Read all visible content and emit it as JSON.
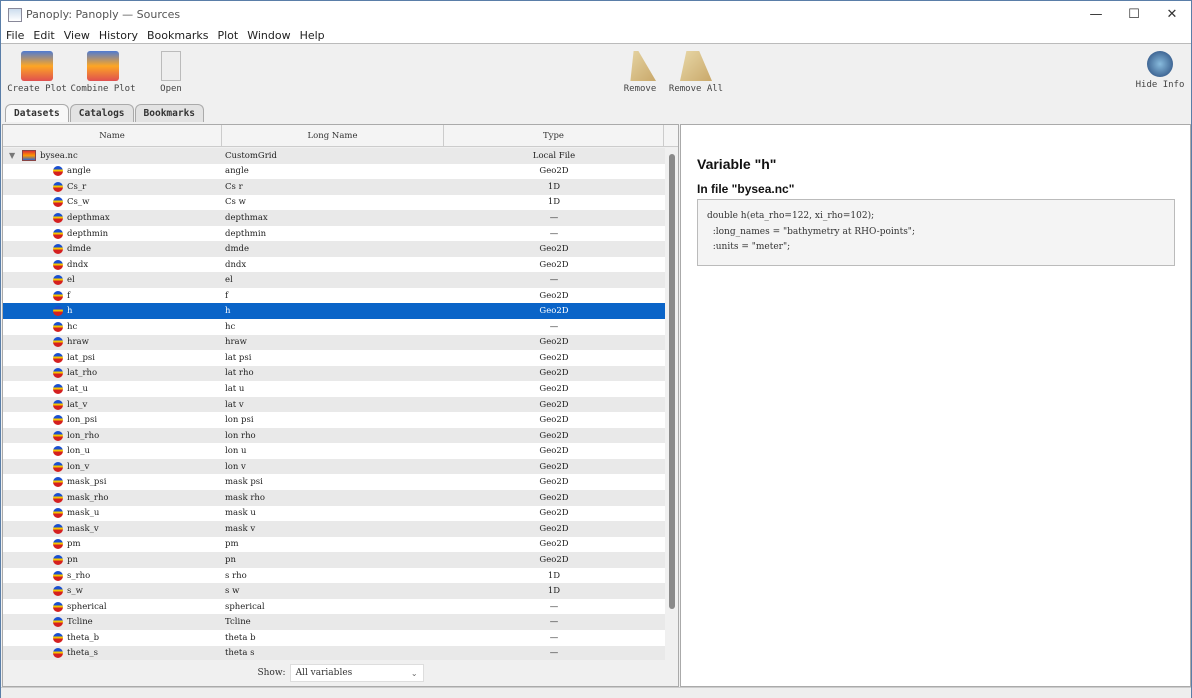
{
  "window": {
    "title": "Panoply: Panoply — Sources",
    "minimize": "—",
    "maximize": "☐",
    "close": "✕"
  },
  "menu": [
    "File",
    "Edit",
    "View",
    "History",
    "Bookmarks",
    "Plot",
    "Window",
    "Help"
  ],
  "toolbar": {
    "create_plot": "Create Plot",
    "combine_plot": "Combine Plot",
    "open": "Open",
    "remove": "Remove",
    "remove_all": "Remove All",
    "hide_info": "Hide Info"
  },
  "tabs": [
    "Datasets",
    "Catalogs",
    "Bookmarks"
  ],
  "table": {
    "headers": [
      "Name",
      "Long Name",
      "Type"
    ],
    "file": {
      "name": "bysea.nc",
      "long_name": "CustomGrid",
      "type": "Local File"
    },
    "selected": "h",
    "rows": [
      [
        "angle",
        "angle",
        "Geo2D"
      ],
      [
        "Cs_r",
        "Cs r",
        "1D"
      ],
      [
        "Cs_w",
        "Cs w",
        "1D"
      ],
      [
        "depthmax",
        "depthmax",
        "—"
      ],
      [
        "depthmin",
        "depthmin",
        "—"
      ],
      [
        "dmde",
        "dmde",
        "Geo2D"
      ],
      [
        "dndx",
        "dndx",
        "Geo2D"
      ],
      [
        "el",
        "el",
        "—"
      ],
      [
        "f",
        "f",
        "Geo2D"
      ],
      [
        "h",
        "h",
        "Geo2D"
      ],
      [
        "hc",
        "hc",
        "—"
      ],
      [
        "hraw",
        "hraw",
        "Geo2D"
      ],
      [
        "lat_psi",
        "lat psi",
        "Geo2D"
      ],
      [
        "lat_rho",
        "lat rho",
        "Geo2D"
      ],
      [
        "lat_u",
        "lat u",
        "Geo2D"
      ],
      [
        "lat_v",
        "lat v",
        "Geo2D"
      ],
      [
        "lon_psi",
        "lon psi",
        "Geo2D"
      ],
      [
        "lon_rho",
        "lon rho",
        "Geo2D"
      ],
      [
        "lon_u",
        "lon u",
        "Geo2D"
      ],
      [
        "lon_v",
        "lon v",
        "Geo2D"
      ],
      [
        "mask_psi",
        "mask psi",
        "Geo2D"
      ],
      [
        "mask_rho",
        "mask rho",
        "Geo2D"
      ],
      [
        "mask_u",
        "mask u",
        "Geo2D"
      ],
      [
        "mask_v",
        "mask v",
        "Geo2D"
      ],
      [
        "pm",
        "pm",
        "Geo2D"
      ],
      [
        "pn",
        "pn",
        "Geo2D"
      ],
      [
        "s_rho",
        "s rho",
        "1D"
      ],
      [
        "s_w",
        "s w",
        "1D"
      ],
      [
        "spherical",
        "spherical",
        "—"
      ],
      [
        "Tcline",
        "Tcline",
        "—"
      ],
      [
        "theta_b",
        "theta b",
        "—"
      ],
      [
        "theta_s",
        "theta s",
        "—"
      ]
    ]
  },
  "show": {
    "label": "Show:",
    "value": "All variables"
  },
  "info": {
    "title": "Variable \"h\"",
    "file": "In file \"bysea.nc\"",
    "code": "double h(eta_rho=122, xi_rho=102);\n  :long_names = \"bathymetry at RHO-points\";\n  :units = \"meter\";"
  }
}
